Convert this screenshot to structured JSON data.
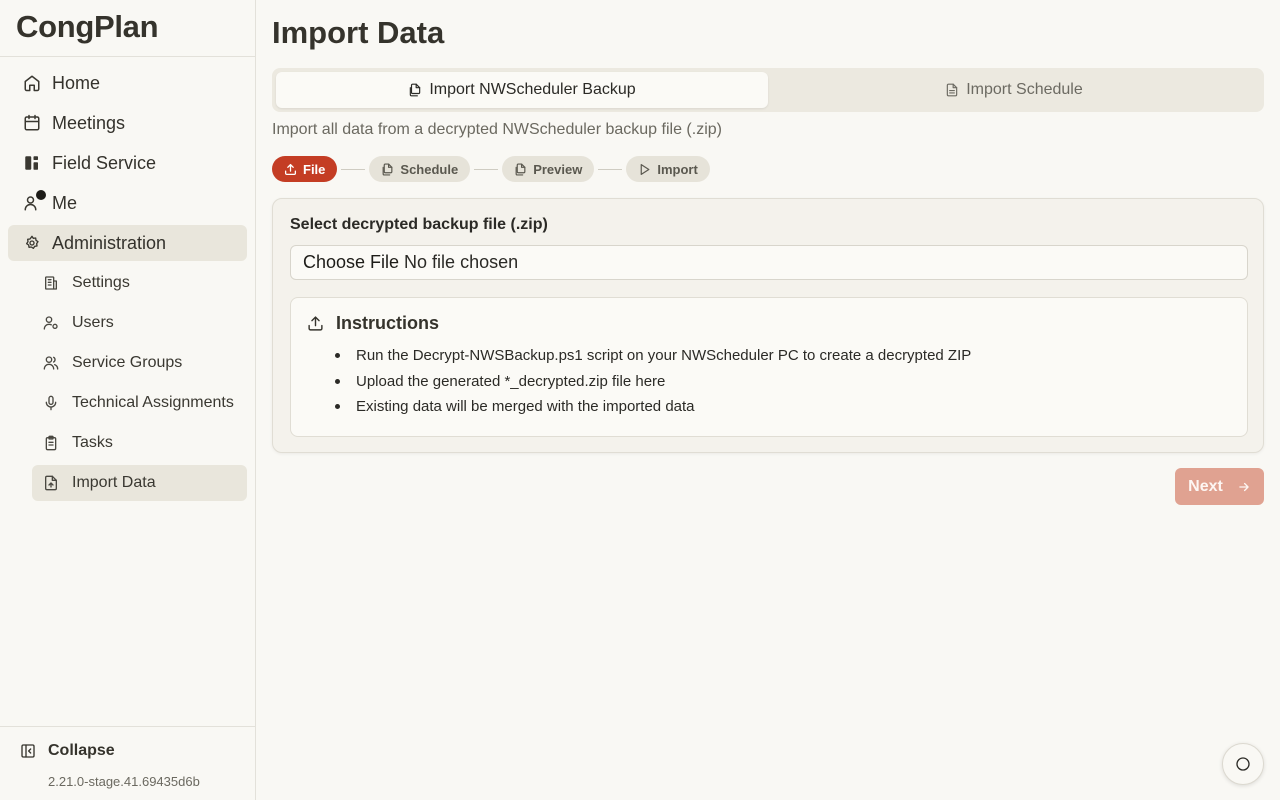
{
  "app": {
    "name": "CongPlan"
  },
  "sidebar": {
    "items": [
      {
        "label": "Home",
        "icon": "home-icon"
      },
      {
        "label": "Meetings",
        "icon": "calendar-icon"
      },
      {
        "label": "Field Service",
        "icon": "field-service-icon"
      },
      {
        "label": "Me",
        "icon": "user-icon",
        "notification_dot": true
      },
      {
        "label": "Administration",
        "icon": "gear-icon",
        "active": true
      }
    ],
    "subitems": [
      {
        "label": "Settings",
        "icon": "building-icon"
      },
      {
        "label": "Users",
        "icon": "user-cog-icon"
      },
      {
        "label": "Service Groups",
        "icon": "users-icon"
      },
      {
        "label": "Technical Assignments",
        "icon": "microphone-icon"
      },
      {
        "label": "Tasks",
        "icon": "clipboard-icon"
      },
      {
        "label": "Import Data",
        "icon": "file-upload-icon",
        "active": true
      }
    ],
    "collapse_label": "Collapse",
    "version": "2.21.0-stage.41.69435d6b"
  },
  "page": {
    "title": "Import Data",
    "tabs": [
      {
        "label": "Import NWScheduler Backup",
        "active": true
      },
      {
        "label": "Import Schedule",
        "active": false
      }
    ],
    "description": "Import all data from a decrypted NWScheduler backup file (.zip)",
    "steps": [
      {
        "label": "File",
        "icon": "upload-icon",
        "active": true
      },
      {
        "label": "Schedule",
        "icon": "file-copy-icon",
        "active": false
      },
      {
        "label": "Preview",
        "icon": "file-copy-icon",
        "active": false
      },
      {
        "label": "Import",
        "icon": "play-icon",
        "active": false
      }
    ],
    "form": {
      "label": "Select decrypted backup file (.zip)",
      "choose_button": "Choose File",
      "file_status": "No file chosen"
    },
    "instructions": {
      "title": "Instructions",
      "items": [
        "Run the Decrypt-NWSBackup.ps1 script on your NWScheduler PC to create a decrypted ZIP",
        "Upload the generated *_decrypted.zip file here",
        "Existing data will be merged with the imported data"
      ]
    },
    "next_label": "Next"
  },
  "colors": {
    "accent": "#c43d24",
    "accent_disabled": "#e0a291",
    "background": "#f9f8f4",
    "active_nav": "#e9e6dc"
  }
}
